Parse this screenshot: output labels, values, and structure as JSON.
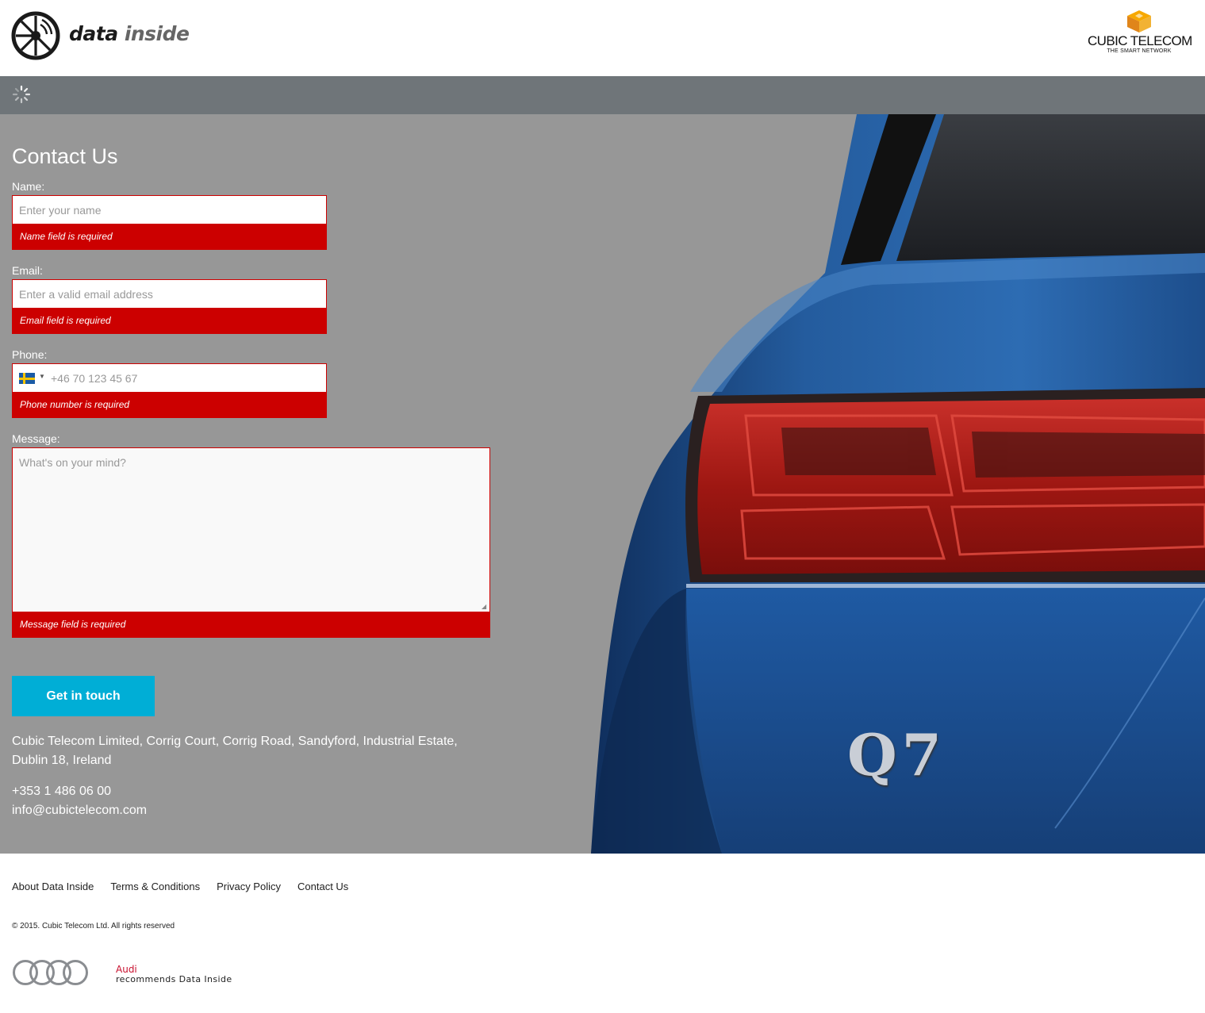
{
  "header": {
    "logo_word1": "data",
    "logo_word2": "inside",
    "partner_name": "CUBIC TELECOM",
    "partner_tagline": "THE SMART NETWORK"
  },
  "form": {
    "title": "Contact Us",
    "name_label": "Name:",
    "name_placeholder": "Enter your name",
    "name_error": "Name field is required",
    "email_label": "Email:",
    "email_placeholder": "Enter a valid email address",
    "email_error": "Email field is required",
    "phone_label": "Phone:",
    "phone_placeholder": "+46 70 123 45 67",
    "phone_country_flag": "sweden-flag-icon",
    "phone_error": "Phone number is required",
    "message_label": "Message:",
    "message_placeholder": "What's on your mind?",
    "message_error": "Message field is required",
    "submit_label": "Get in touch"
  },
  "contact": {
    "address": "Cubic Telecom Limited, Corrig Court, Corrig Road, Sandyford, Industrial Estate, Dublin 18, Ireland",
    "phone": "+353 1 486 06 00",
    "email": "info@cubictelecom.com"
  },
  "footer": {
    "links": [
      "About Data Inside",
      "Terms & Conditions",
      "Privacy Policy",
      "Contact Us"
    ],
    "copyright": "© 2015. Cubic Telecom Ltd. All rights reserved",
    "audi_brand": "Audi",
    "audi_recommends": "recommends Data Inside"
  },
  "hero": {
    "badge_text": "Q7"
  },
  "colors": {
    "error": "#cc0000",
    "button": "#00aed6",
    "toolbar": "#6f7579",
    "hero_bg": "#979797",
    "car_blue": "#1f4f8f"
  }
}
